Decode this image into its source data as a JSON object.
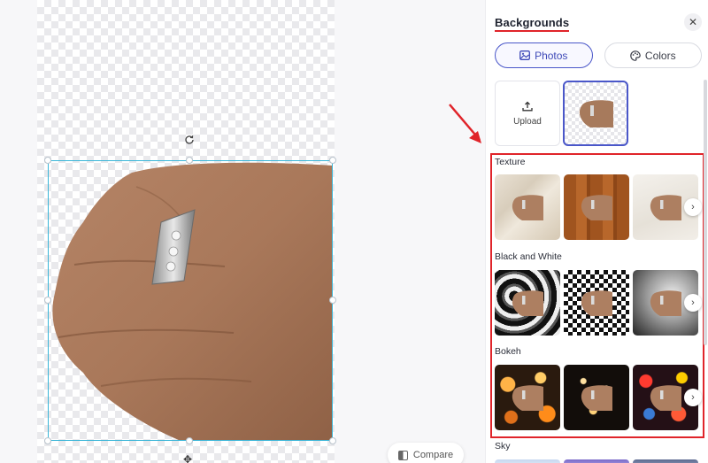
{
  "editor": {
    "compare_label": "Compare"
  },
  "panel": {
    "title": "Backgrounds",
    "tabs": [
      {
        "label": "Photos",
        "icon": "image-icon",
        "active": true
      },
      {
        "label": "Colors",
        "icon": "palette-icon",
        "active": false
      }
    ],
    "upload_label": "Upload",
    "sections": [
      {
        "label": "Texture"
      },
      {
        "label": "Black and White"
      },
      {
        "label": "Bokeh"
      },
      {
        "label": "Sky"
      }
    ]
  },
  "colors": {
    "accent": "#4a57c9",
    "annotation": "#e0242a",
    "selection": "#3bb6d8"
  }
}
